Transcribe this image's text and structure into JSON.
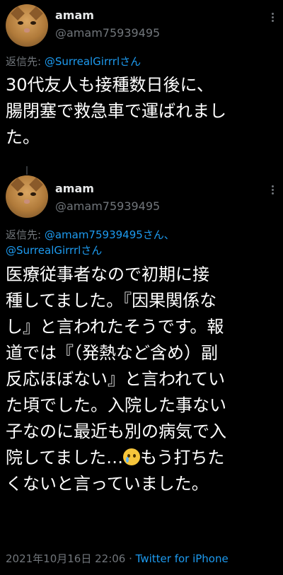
{
  "tweet1": {
    "name": "amam",
    "handle": "@amam75939495",
    "reply_prefix": "返信先: ",
    "reply_to": "@SurrealGirrrlさん",
    "text": "30代友人も接種数日後に、\n腸閉塞で救急車で運ばれまし\nた。"
  },
  "tweet2": {
    "name": "amam",
    "handle": "@amam75939495",
    "reply_prefix": "返信先: ",
    "reply_to_1": "@amam75939495さん、",
    "reply_to_2": "@SurrealGirrrlさん",
    "text_part1": "医療従事者なので初期に接\n種してました。『因果関係な\nし』と言われたそうです。報\n道では『（発熱など含め）副\n反応ほぼない』と言われてい\nた頃でした。入院した事ない\n子なのに最近も別の病気で入\n院してました…",
    "emoji": "crying-face",
    "text_part2": "もう打ちた\nくないと言っていました。",
    "timestamp": "2021年10月16日 22:06",
    "separator": " · ",
    "source": "Twitter for iPhone"
  },
  "colors": {
    "background": "#000000",
    "text": "#ffffff",
    "muted": "#71767b",
    "link": "#1d9bf0"
  }
}
